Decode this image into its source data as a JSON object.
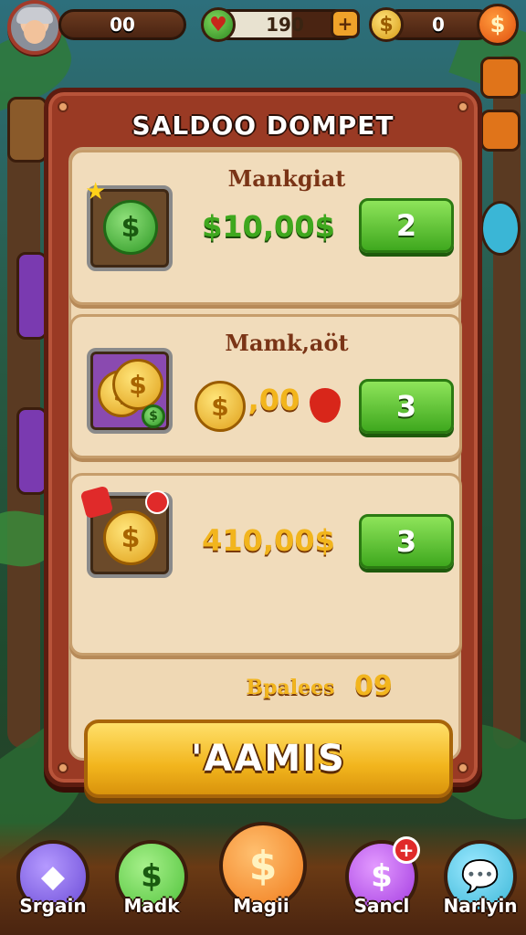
{
  "hud": {
    "xp_value": "00",
    "energy_value": "190",
    "gold_value": "0",
    "plus_label": "+",
    "dollar_symbol": "$"
  },
  "dialog": {
    "title": "SALDOO DOMPET",
    "offers": [
      {
        "title": "Mankgiat",
        "price": "$10,00$",
        "price_color": "#3fa81e",
        "button_label": "2",
        "icon": "green-dollar-coin-icon"
      },
      {
        "title": "Mamk,aöt",
        "price": ",00",
        "price_color": "#f2b51d",
        "button_label": "3",
        "icon": "gold-coin-stack-icon"
      },
      {
        "title": "",
        "price": "410,00$",
        "price_color": "#f2b51d",
        "button_label": "3",
        "icon": "gold-dollar-coin-icon"
      }
    ],
    "balance_label": "Bpalees",
    "balance_value": "09",
    "main_button_label": "'AAMIS"
  },
  "bottom_nav": [
    {
      "label": "Srgain",
      "icon": "purple-gem-icon",
      "color": "#6a4ad6"
    },
    {
      "label": "Madk",
      "icon": "green-dollar-icon",
      "color": "#4fc23a"
    },
    {
      "label": "Magii",
      "icon": "orange-dollar-icon",
      "color": "#f07a1a"
    },
    {
      "label": "Sancl",
      "icon": "purple-dollar-icon",
      "color": "#a23ae0"
    },
    {
      "label": "Narlyin",
      "icon": "chat-bubble-icon",
      "color": "#3ab6d6"
    }
  ],
  "colors": {
    "accent_gold": "#f2b51d",
    "buy_green": "#3fa81e",
    "panel_frame": "#9a3a24"
  }
}
